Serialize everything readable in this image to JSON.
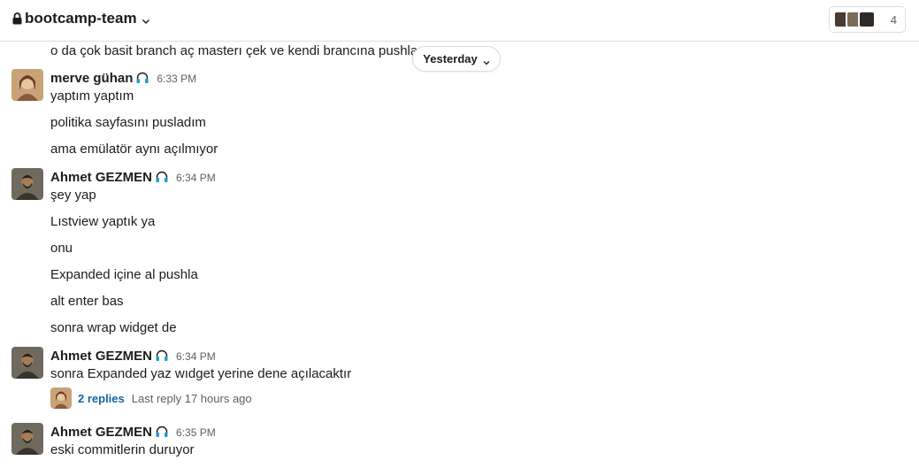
{
  "header": {
    "channel_name": "bootcamp-team",
    "member_count": "4",
    "icons": [
      "lock-icon",
      "chevron-down-icon"
    ]
  },
  "date_divider": {
    "label": "Yesterday"
  },
  "messages": [
    {
      "text": "o da çok basit branch aç masterı çek ve kendi brancına pushla"
    },
    {
      "author": "merve gühan",
      "time": "6:33 PM",
      "lines": [
        "yaptım yaptım",
        "politika sayfasını pusladım",
        "ama emülatör aynı açılmıyor"
      ]
    },
    {
      "author": "Ahmet GEZMEN",
      "time": "6:34 PM",
      "lines": [
        "şey yap",
        "Lıstview yaptık ya",
        "onu",
        "Expanded içine al pushla",
        "alt enter bas",
        "sonra wrap widget de"
      ]
    },
    {
      "author": "Ahmet GEZMEN",
      "time": "6:34 PM",
      "lines": [
        "sonra Expanded yaz wıdget yerine dene açılacaktır"
      ],
      "thread": {
        "replies": "2 replies",
        "last_reply": "Last reply 17 hours ago"
      }
    },
    {
      "author": "Ahmet GEZMEN",
      "time": "6:35 PM",
      "lines": [
        "eski commitlerin duruyor"
      ]
    }
  ]
}
